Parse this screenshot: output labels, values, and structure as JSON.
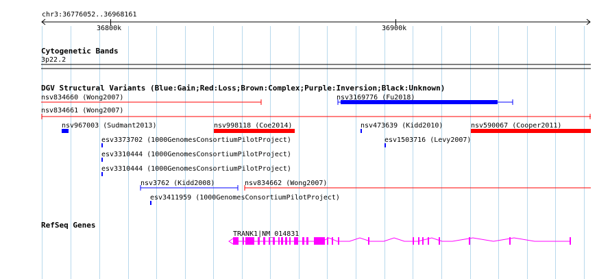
{
  "ruler": {
    "range_label": "chr3:36776052..36968161",
    "ticks": [
      {
        "label": "36800k",
        "pos": 36800000
      },
      {
        "label": "36900k",
        "pos": 36900000
      }
    ],
    "start": 36776052,
    "end": 36968161
  },
  "cytoband": {
    "title": "Cytogenetic Bands",
    "band": "3p22.2"
  },
  "dgv": {
    "title": "DGV Structural Variants (Blue:Gain;Red:Loss;Brown:Complex;Purple:Inversion;Black:Unknown)",
    "colors": {
      "gain": "#0000ff",
      "loss": "#ff0000"
    },
    "features": [
      {
        "label": "nsv834660 (Wong2007)",
        "kind": "loss",
        "style": "thin"
      },
      {
        "label": "nsv3169776 (Fu2018)",
        "kind": "gain",
        "style": "thick-core"
      },
      {
        "label": "nsv834661 (Wong2007)",
        "kind": "loss",
        "style": "thin"
      },
      {
        "label": "nsv967003 (Sudmant2013)",
        "kind": "gain",
        "style": "thick"
      },
      {
        "label": "nsv998118 (Coe2014)",
        "kind": "loss",
        "style": "thick"
      },
      {
        "label": "nsv473639 (Kidd2010)",
        "kind": "gain",
        "style": "tick"
      },
      {
        "label": "nsv590067 (Cooper2011)",
        "kind": "loss",
        "style": "thick"
      },
      {
        "label": "esv3373702 (1000GenomesConsortiumPilotProject)",
        "kind": "gain",
        "style": "tick"
      },
      {
        "label": "esv1503716 (Levy2007)",
        "kind": "gain",
        "style": "tick"
      },
      {
        "label": "esv3310444 (1000GenomesConsortiumPilotProject)",
        "kind": "gain",
        "style": "tick"
      },
      {
        "label": "esv3310444 (1000GenomesConsortiumPilotProject)",
        "kind": "gain",
        "style": "tick"
      },
      {
        "label": "nsv3762 (Kidd2008)",
        "kind": "gain",
        "style": "thin"
      },
      {
        "label": "nsv834662 (Wong2007)",
        "kind": "loss",
        "style": "thin"
      },
      {
        "label": "esv3411959 (1000GenomesConsortiumPilotProject)",
        "kind": "gain",
        "style": "tick"
      }
    ]
  },
  "refseq": {
    "title": "RefSeq Genes",
    "color": "#ff00ff",
    "gene_label": "TRANK1|NM_014831",
    "strand": "minus"
  }
}
